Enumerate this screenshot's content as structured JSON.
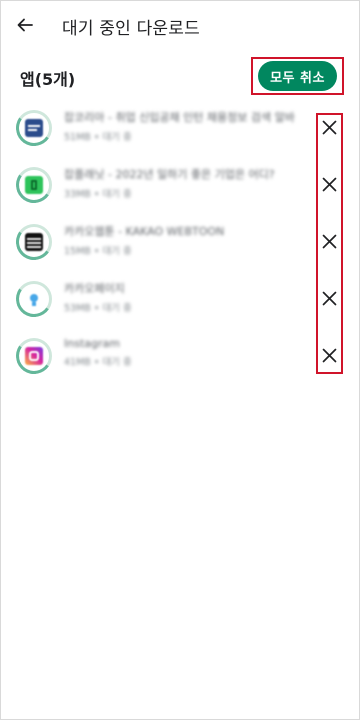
{
  "header": {
    "title": "대기 중인 다운로드"
  },
  "section": {
    "title": "앱(5개)",
    "cancel_all_label": "모두 취소"
  },
  "apps": [
    {
      "name": "잡코리아 - 취업 신입공채 인턴 채용정보 검색 알바",
      "meta": "51MB • 대기 중",
      "icon_color": "#2b4c8c",
      "icon_accent": "#ffffff"
    },
    {
      "name": "잡플래닛 - 2022년 일하기 좋은 기업은 어디?",
      "meta": "33MB • 대기 중",
      "icon_color": "#2ec45b",
      "icon_accent": "#0b6b2c"
    },
    {
      "name": "카카오웹툰 - KAKAO WEBTOON",
      "meta": "15MB • 대기 중",
      "icon_color": "#111111",
      "icon_accent": "#e8e8e8"
    },
    {
      "name": "카카오페이지",
      "meta": "53MB • 대기 중",
      "icon_color": "#ffffff",
      "icon_accent": "#47a7e8"
    },
    {
      "name": "Instagram",
      "meta": "41MB • 대기 중",
      "icon_color": "#d6249f",
      "icon_accent": "#fdb543"
    }
  ],
  "colors": {
    "accent": "#01875f",
    "highlight": "#d0142a"
  }
}
